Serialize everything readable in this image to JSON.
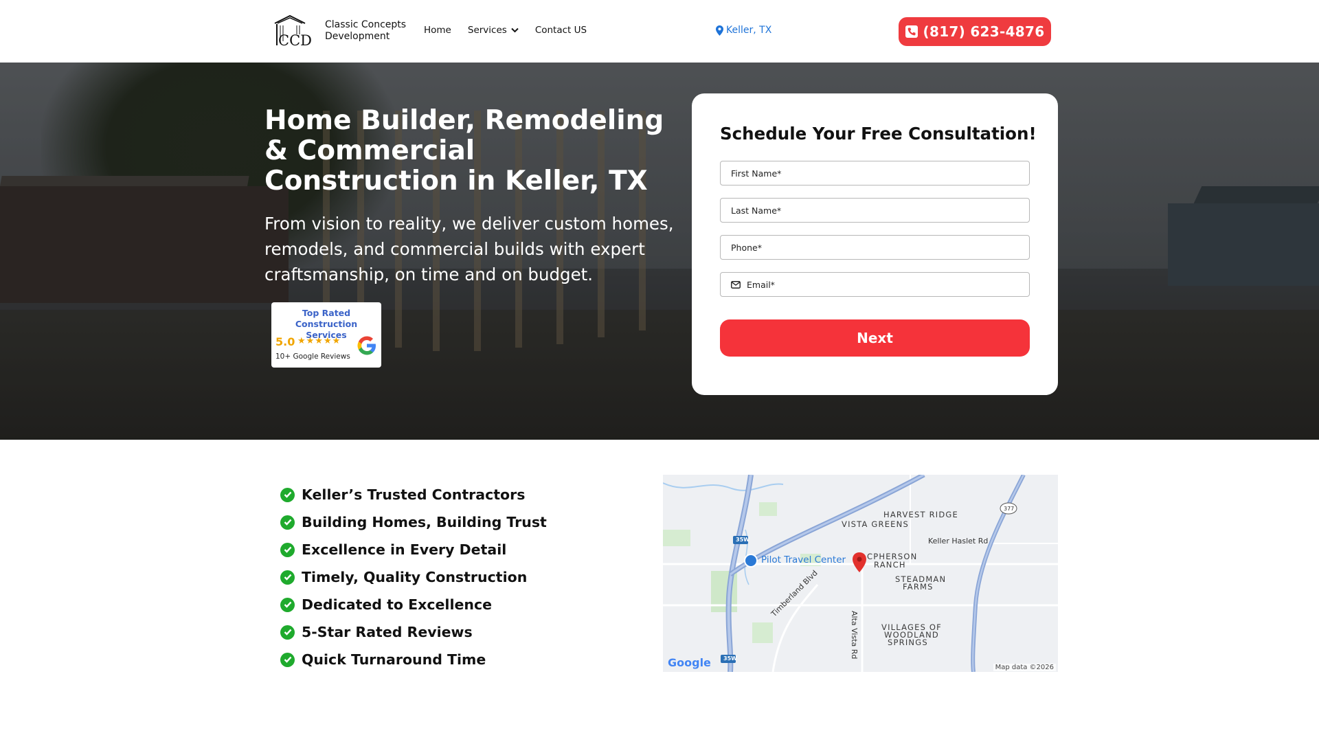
{
  "header": {
    "brand_line1": "Classic Concepts",
    "brand_line2": "Development",
    "logo_text": "CCD",
    "nav": [
      {
        "label": "Home"
      },
      {
        "label": "Services"
      },
      {
        "label": "Contact US"
      }
    ],
    "location": "Keller, TX",
    "phone": "(817) 623-4876"
  },
  "hero": {
    "title": "Home Builder, Remodeling & Commercial Construction in Keller, TX",
    "subtitle": "From vision to reality, we deliver custom homes, remodels, and commercial builds with expert craftsmanship, on time and on budget.",
    "badge": {
      "title": "Top Rated Construction Services",
      "rating": "5.0",
      "stars": 5,
      "reviews": "10+ Google Reviews"
    }
  },
  "form": {
    "title": "Schedule Your Free Consultation!",
    "first_name": "First Name*",
    "last_name": "Last Name*",
    "phone": "Phone*",
    "email": "Email*",
    "next_label": "Next"
  },
  "features": [
    "Keller’s Trusted Contractors",
    "Building Homes, Building Trust",
    "Excellence in Every Detail",
    "Timely, Quality Construction",
    "Dedicated to Excellence",
    "5-Star Rated Reviews",
    "Quick Turnaround Time"
  ],
  "map": {
    "areas": {
      "harvest_ridge": "HARVEST RIDGE",
      "vista_greens": "VISTA GREENS",
      "mcpherson_1": "CPHERSON",
      "mcpherson_2": "RANCH",
      "steadman_1": "STEADMAN",
      "steadman_2": "FARMS",
      "villages_1": "VILLAGES OF",
      "villages_2": "WOODLAND",
      "villages_3": "SPRINGS"
    },
    "roads": {
      "keller_haslet": "Keller Haslet Rd",
      "timberland": "Timberland Blvd",
      "alta_vista": "Alta Vista Rd"
    },
    "poi": "Pilot Travel Center",
    "highway_35w": "35W",
    "highway_377": "377",
    "google": "Google",
    "map_data": "Map data ©2026"
  }
}
